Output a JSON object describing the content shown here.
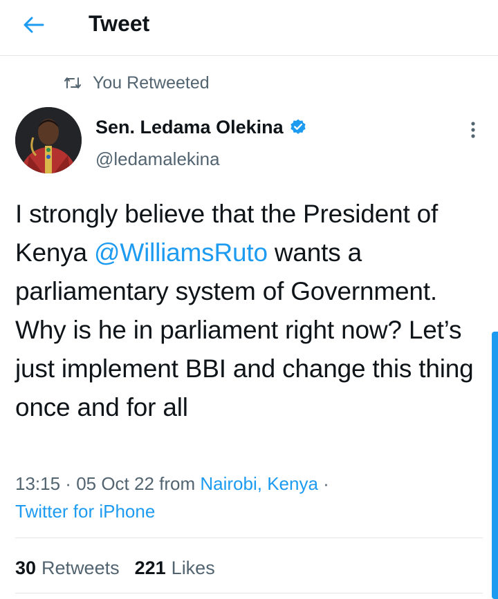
{
  "header": {
    "back_icon": "arrow-left-icon",
    "title": "Tweet"
  },
  "retweet": {
    "icon": "retweet-icon",
    "label": "You Retweeted"
  },
  "author": {
    "name": "Sen. Ledama Olekina",
    "handle": "@ledamalekina",
    "verified_icon": "verified-badge-icon",
    "more_icon": "more-vertical-icon"
  },
  "tweet": {
    "text_part1": "I strongly believe that the President of Kenya ",
    "mention": "@WilliamsRuto",
    "text_part2": " wants a parliamentary system of Government. Why is he in parliament right now? Let’s just implement BBI and change this thing once and for all"
  },
  "meta": {
    "time": "13:15",
    "sep1": " · ",
    "date": "05 Oct 22",
    "from": " from ",
    "location": "Nairobi, Kenya",
    "sep2": " · ",
    "client": "Twitter for iPhone"
  },
  "stats": {
    "retweets_count": "30",
    "retweets_label": "Retweets",
    "likes_count": "221",
    "likes_label": "Likes"
  },
  "colors": {
    "accent": "#1d9bf0",
    "text": "#0f1419",
    "secondary": "#536471",
    "divider": "#e2e5e8"
  }
}
